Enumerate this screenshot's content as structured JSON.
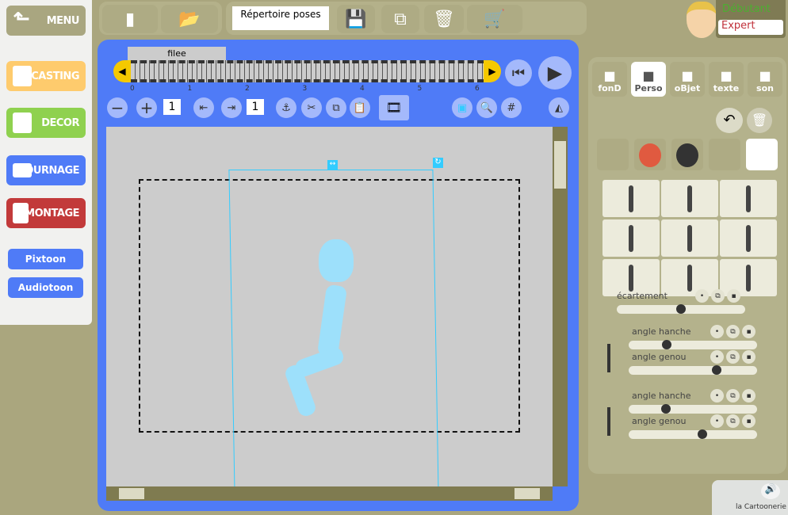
{
  "left_menu": {
    "menu": "MENU",
    "casting": "CASTING",
    "decor": "DECOR",
    "tournage": "TOURNAGE",
    "montage": "MONTAGE",
    "pixtoon": "Pixtoon",
    "audiotoon": "Audiotoon"
  },
  "toolbar": {
    "poses_label": "Répertoire poses"
  },
  "level": {
    "beginner": "Débutant",
    "expert": "Expert"
  },
  "timeline": {
    "track_label": "filee",
    "ticks": [
      "0",
      "1",
      "2",
      "3",
      "4",
      "5",
      "6"
    ],
    "zoom_value": "1",
    "step_value": "1"
  },
  "right_panel": {
    "tabs": [
      {
        "label": "fonD",
        "icon": "house-icon"
      },
      {
        "label": "Perso",
        "icon": "character-icon"
      },
      {
        "label": "oBjet",
        "icon": "shapes-icon"
      },
      {
        "label": "texte",
        "icon": "speech-bubble-icon"
      },
      {
        "label": "son",
        "icon": "music-icon"
      }
    ],
    "selected_tab": "Perso",
    "sliders": [
      {
        "label": "écartement",
        "value": 0.5
      },
      {
        "label": "angle hanche",
        "value": 0.28
      },
      {
        "label": "angle genou",
        "value": 0.7
      },
      {
        "label": "angle hanche",
        "value": 0.27
      },
      {
        "label": "angle genou",
        "value": 0.58
      }
    ]
  },
  "footer": {
    "brand": "la Cartoonerie"
  },
  "colors": {
    "blue": "#4f7bf7",
    "casting": "#fecb6d",
    "decor": "#8fd14f",
    "montage": "#c23a3a",
    "olive": "#aaa67e",
    "selection": "#33ccff"
  }
}
